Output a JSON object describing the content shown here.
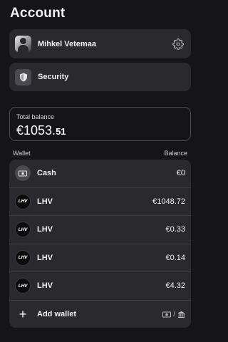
{
  "header": {
    "title": "Account"
  },
  "profile": {
    "name": "Mihkel Vetemaa",
    "avatar_icon": "user-photo",
    "settings_icon": "gear-icon"
  },
  "security": {
    "label": "Security",
    "icon": "shield-icon"
  },
  "balance": {
    "label": "Total balance",
    "whole": "€1053.",
    "cents": "51"
  },
  "wallets_header": {
    "left": "Wallet",
    "right": "Balance"
  },
  "wallets": [
    {
      "name": "Cash",
      "amount": "€0",
      "icon": "cash-icon"
    },
    {
      "name": "LHV",
      "amount": "€1048.72",
      "icon": "lhv-logo"
    },
    {
      "name": "LHV",
      "amount": "€0.33",
      "icon": "lhv-logo"
    },
    {
      "name": "LHV",
      "amount": "€0.14",
      "icon": "lhv-logo"
    },
    {
      "name": "LHV",
      "amount": "€4.32",
      "icon": "lhv-logo"
    }
  ],
  "lhv_logo_text": "LHV",
  "add_wallet": {
    "label": "Add wallet",
    "plus": "+",
    "separator": "/"
  },
  "colors": {
    "background": "#151517",
    "card": "#2a2a2e",
    "text": "#f2f2f4"
  }
}
